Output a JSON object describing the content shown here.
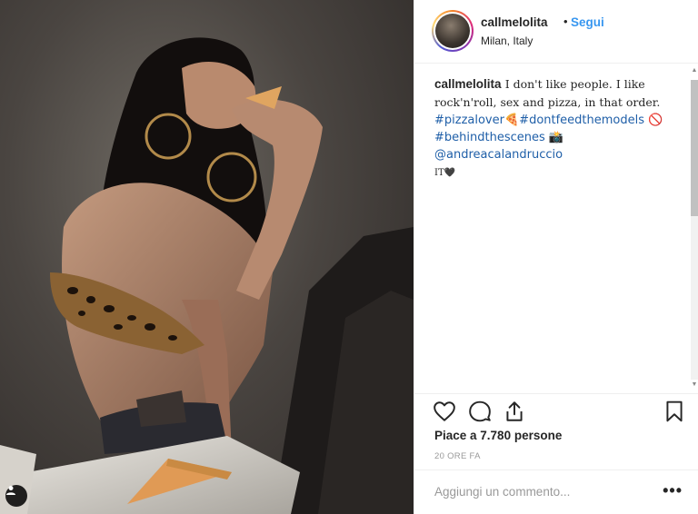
{
  "post": {
    "username": "callmelolita",
    "separator": "•",
    "follow_label": "Segui",
    "location": "Milan, Italy"
  },
  "caption": {
    "username": "callmelolita",
    "text_line1": "I don't like people. I like",
    "text_line2": "rock'n'roll, sex and pizza, in that order.",
    "hashtag1": "#pizzalover",
    "emoji1": "🍕",
    "hashtag2": "#dontfeedthemodels",
    "emoji2": "🚫",
    "hashtag3": "#behindthescenes",
    "emoji3": "📸",
    "mention": "@andreacalandruccio",
    "suffix": "IT🖤"
  },
  "actions": {
    "likes_text": "Piace a 7.780 persone",
    "time_text": "20 ORE FA"
  },
  "comment": {
    "placeholder": "Aggiungi un commento...",
    "more_label": "•••"
  },
  "icons": [
    "heart-icon",
    "comment-icon",
    "share-icon",
    "bookmark-icon",
    "user-tag-icon"
  ]
}
